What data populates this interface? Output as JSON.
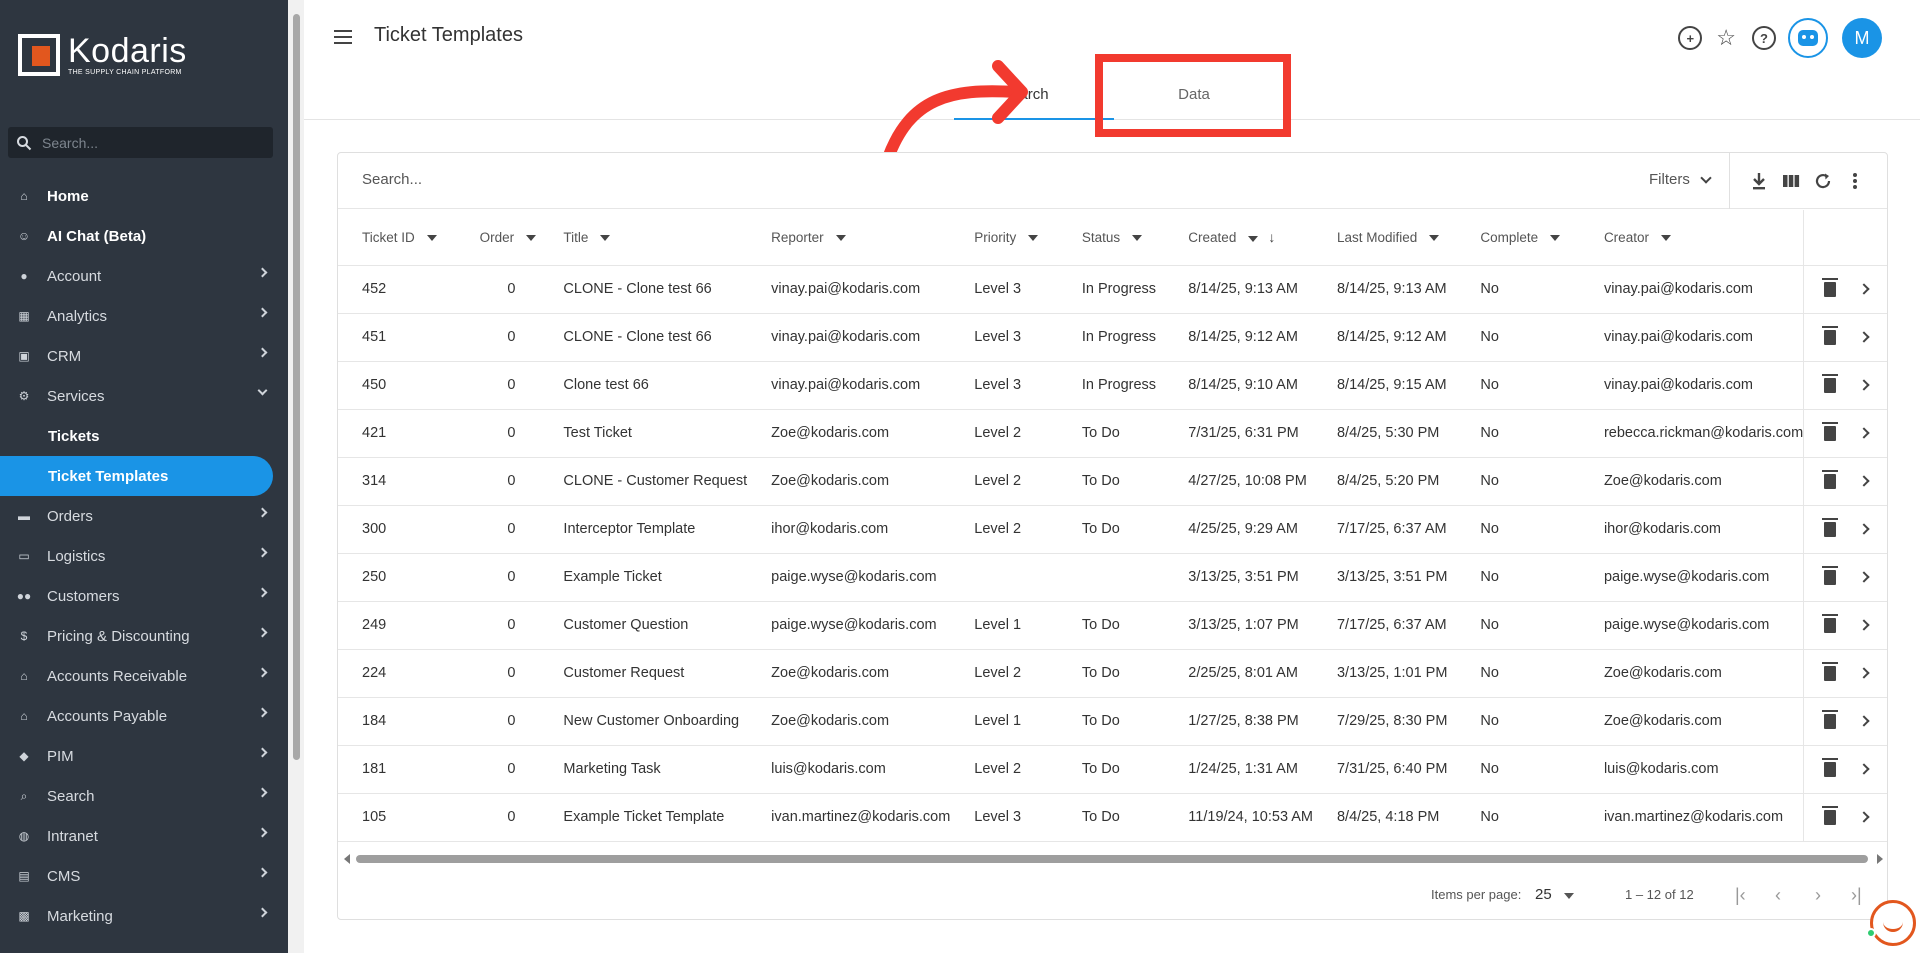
{
  "app": {
    "brand": "Kodaris",
    "tagline": "THE SUPPLY CHAIN PLATFORM",
    "sidebar_search_placeholder": "Search...",
    "accent": "#1a94e6",
    "sidebar_bg": "#2e3640"
  },
  "sidebar": {
    "items": [
      {
        "label": "Home",
        "icon": "home-icon",
        "style": "bold"
      },
      {
        "label": "AI Chat (Beta)",
        "icon": "robot-icon",
        "style": "bold"
      },
      {
        "label": "Account",
        "icon": "person-icon",
        "chevron": "right"
      },
      {
        "label": "Analytics",
        "icon": "chart-icon",
        "chevron": "right"
      },
      {
        "label": "CRM",
        "icon": "contacts-icon",
        "chevron": "right"
      },
      {
        "label": "Services",
        "icon": "services-icon",
        "chevron": "down"
      },
      {
        "label": "Tickets",
        "style": "sub"
      },
      {
        "label": "Ticket Templates",
        "style": "active"
      },
      {
        "label": "Orders",
        "icon": "truck-icon",
        "chevron": "right"
      },
      {
        "label": "Logistics",
        "icon": "shipping-icon",
        "chevron": "right"
      },
      {
        "label": "Customers",
        "icon": "group-icon",
        "chevron": "right"
      },
      {
        "label": "Pricing & Discounting",
        "icon": "dollar-icon",
        "chevron": "right"
      },
      {
        "label": "Accounts Receivable",
        "icon": "bank-icon",
        "chevron": "right"
      },
      {
        "label": "Accounts Payable",
        "icon": "bank-icon",
        "chevron": "right"
      },
      {
        "label": "PIM",
        "icon": "tag-icon",
        "chevron": "right"
      },
      {
        "label": "Search",
        "icon": "search-icon",
        "chevron": "right"
      },
      {
        "label": "Intranet",
        "icon": "globe-icon",
        "chevron": "right"
      },
      {
        "label": "CMS",
        "icon": "cms-icon",
        "chevron": "right"
      },
      {
        "label": "Marketing",
        "icon": "marketing-icon",
        "chevron": "right"
      }
    ]
  },
  "header": {
    "title": "Ticket Templates",
    "avatar_initial": "M",
    "tabs": [
      {
        "label": "Search",
        "visible_text": "arch",
        "active": true
      },
      {
        "label": "Data",
        "active": false
      }
    ]
  },
  "annotation": {
    "highlight_color": "#f23a2f"
  },
  "table": {
    "search_placeholder": "Search...",
    "filters_label": "Filters",
    "columns": [
      "Ticket ID",
      "Order",
      "Title",
      "Reporter",
      "Priority",
      "Status",
      "Created",
      "Last Modified",
      "Complete",
      "Creator"
    ],
    "rows": [
      [
        "452",
        "0",
        "CLONE - Clone test 66",
        "vinay.pai@kodaris.com",
        "Level 3",
        "In Progress",
        "8/14/25, 9:13 AM",
        "8/14/25, 9:13 AM",
        "No",
        "vinay.pai@kodaris.com"
      ],
      [
        "451",
        "0",
        "CLONE - Clone test 66",
        "vinay.pai@kodaris.com",
        "Level 3",
        "In Progress",
        "8/14/25, 9:12 AM",
        "8/14/25, 9:12 AM",
        "No",
        "vinay.pai@kodaris.com"
      ],
      [
        "450",
        "0",
        "Clone test 66",
        "vinay.pai@kodaris.com",
        "Level 3",
        "In Progress",
        "8/14/25, 9:10 AM",
        "8/14/25, 9:15 AM",
        "No",
        "vinay.pai@kodaris.com"
      ],
      [
        "421",
        "0",
        "Test Ticket",
        "Zoe@kodaris.com",
        "Level 2",
        "To Do",
        "7/31/25, 6:31 PM",
        "8/4/25, 5:30 PM",
        "No",
        "rebecca.rickman@kodaris.com"
      ],
      [
        "314",
        "0",
        "CLONE - Customer Request",
        "Zoe@kodaris.com",
        "Level 2",
        "To Do",
        "4/27/25, 10:08 PM",
        "8/4/25, 5:20 PM",
        "No",
        "Zoe@kodaris.com"
      ],
      [
        "300",
        "0",
        "Interceptor Template",
        "ihor@kodaris.com",
        "Level 2",
        "To Do",
        "4/25/25, 9:29 AM",
        "7/17/25, 6:37 AM",
        "No",
        "ihor@kodaris.com"
      ],
      [
        "250",
        "0",
        "Example Ticket",
        "paige.wyse@kodaris.com",
        "",
        "",
        "3/13/25, 3:51 PM",
        "3/13/25, 3:51 PM",
        "No",
        "paige.wyse@kodaris.com"
      ],
      [
        "249",
        "0",
        "Customer Question",
        "paige.wyse@kodaris.com",
        "Level 1",
        "To Do",
        "3/13/25, 1:07 PM",
        "7/17/25, 6:37 AM",
        "No",
        "paige.wyse@kodaris.com"
      ],
      [
        "224",
        "0",
        "Customer Request",
        "Zoe@kodaris.com",
        "Level 2",
        "To Do",
        "2/25/25, 8:01 AM",
        "3/13/25, 1:01 PM",
        "No",
        "Zoe@kodaris.com"
      ],
      [
        "184",
        "0",
        "New Customer Onboarding",
        "Zoe@kodaris.com",
        "Level 1",
        "To Do",
        "1/27/25, 8:38 PM",
        "7/29/25, 8:30 PM",
        "No",
        "Zoe@kodaris.com"
      ],
      [
        "181",
        "0",
        "Marketing Task",
        "luis@kodaris.com",
        "Level 2",
        "To Do",
        "1/24/25, 1:31 AM",
        "7/31/25, 6:40 PM",
        "No",
        "luis@kodaris.com"
      ],
      [
        "105",
        "0",
        "Example Ticket Template",
        "ivan.martinez@kodaris.com",
        "Level 3",
        "To Do",
        "11/19/24, 10:53 AM",
        "8/4/25, 4:18 PM",
        "No",
        "ivan.martinez@kodaris.com"
      ]
    ]
  },
  "pagination": {
    "items_per_page_label": "Items per page:",
    "items_per_page": "25",
    "range": "1 – 12 of 12"
  }
}
